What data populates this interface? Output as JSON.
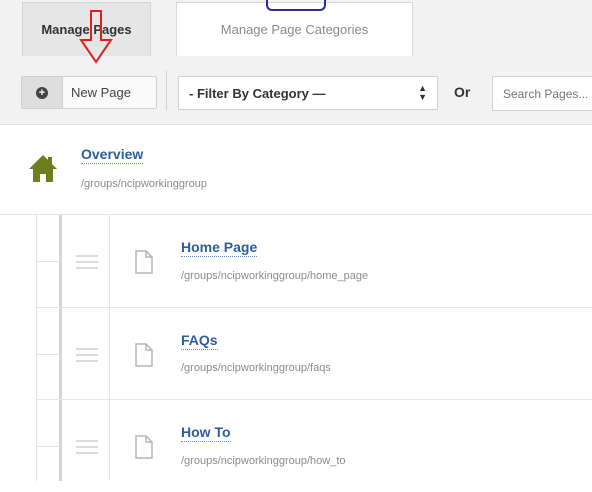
{
  "tabs": {
    "manage_pages": "Manage Pages",
    "manage_page_categories": "Manage Page Categories"
  },
  "toolbar": {
    "new_page_label": "New Page",
    "filter_select": "- Filter By Category —",
    "or_label": "Or",
    "search_placeholder": "Search Pages..."
  },
  "overview": {
    "title": "Overview",
    "path": "/groups/ncipworkinggroup"
  },
  "pages": [
    {
      "title": "Home Page",
      "path": "/groups/ncipworkinggroup/home_page"
    },
    {
      "title": "FAQs",
      "path": "/groups/ncipworkinggroup/faqs"
    },
    {
      "title": "How To",
      "path": "/groups/ncipworkinggroup/how_to"
    }
  ],
  "colors": {
    "link": "#2f5e9c",
    "home_icon": "#6b7f1e",
    "annotation_arrow": "#e02020",
    "annotation_box": "#2a2f8f"
  },
  "icons": [
    "plus-circle-icon",
    "select-arrows-icon",
    "home-icon",
    "drag-handle-icon",
    "document-icon",
    "annotation-arrow"
  ]
}
